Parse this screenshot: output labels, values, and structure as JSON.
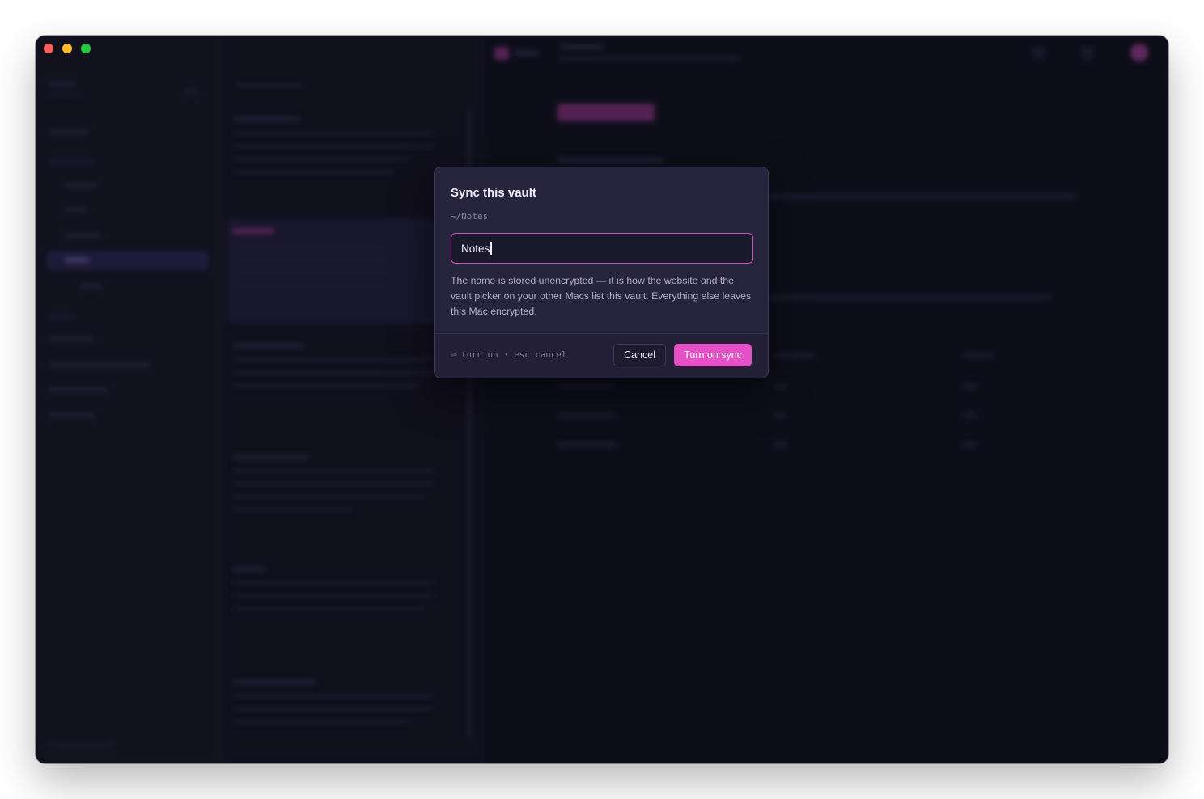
{
  "dialog": {
    "title": "Sync this vault",
    "path": "~/Notes",
    "name_input_value": "Notes",
    "help_text": "The name is stored unencrypted — it is how the website and the vault picker on your other Macs list this vault. Everything else leaves this Mac encrypted.",
    "hint_return_glyph": "⏎",
    "hint_text": "turn on · esc cancel",
    "cancel_label": "Cancel",
    "confirm_label": "Turn on sync"
  },
  "colors": {
    "accent": "#e650c7",
    "dialog_bg": "#27243d",
    "window_bg": "#121220"
  }
}
